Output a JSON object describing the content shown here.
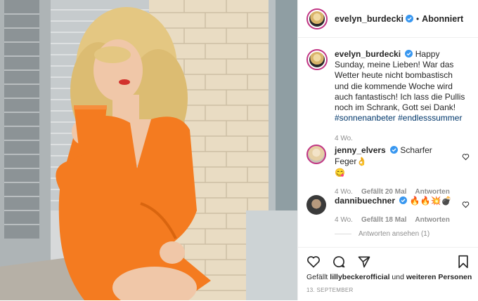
{
  "header": {
    "username": "evelyn_burdecki",
    "separator": "•",
    "follow_label": "Abonniert"
  },
  "caption": {
    "username": "evelyn_burdecki",
    "text": "Happy Sunday, meine Lieben! War das Wetter heute nicht bombastisch und die kommende Woche wird auch fantastisch! Ich lass die Pullis noch im Schrank, Gott sei Dank!",
    "hashtag_1": "#sonnenanbeter",
    "hashtag_2": "#endlesssummer",
    "time": "4 Wo."
  },
  "comments": [
    {
      "username": "jenny_elvers",
      "text": "Scharfer Feger👌",
      "text_line2": "😋",
      "time": "4 Wo.",
      "likes": "Gefällt 20 Mal",
      "reply": "Antworten"
    },
    {
      "username": "dannibuechner",
      "text": "🔥🔥💥💣",
      "time": "4 Wo.",
      "likes": "Gefällt 18 Mal",
      "reply": "Antworten"
    }
  ],
  "view_replies": "Antworten ansehen (1)",
  "likes_line": {
    "prefix": "Gefällt",
    "user": "lillybeckerofficial",
    "middle": "und",
    "others": "weiteren Personen"
  },
  "date": "13. SEPTEMBER",
  "colors": {
    "verified": "#3897f0",
    "hashtag": "#00376b",
    "muted": "#8e8e8e",
    "dress": "#f47b20"
  },
  "icons": [
    "verified-icon",
    "heart-icon",
    "comment-icon",
    "share-icon",
    "bookmark-icon"
  ]
}
